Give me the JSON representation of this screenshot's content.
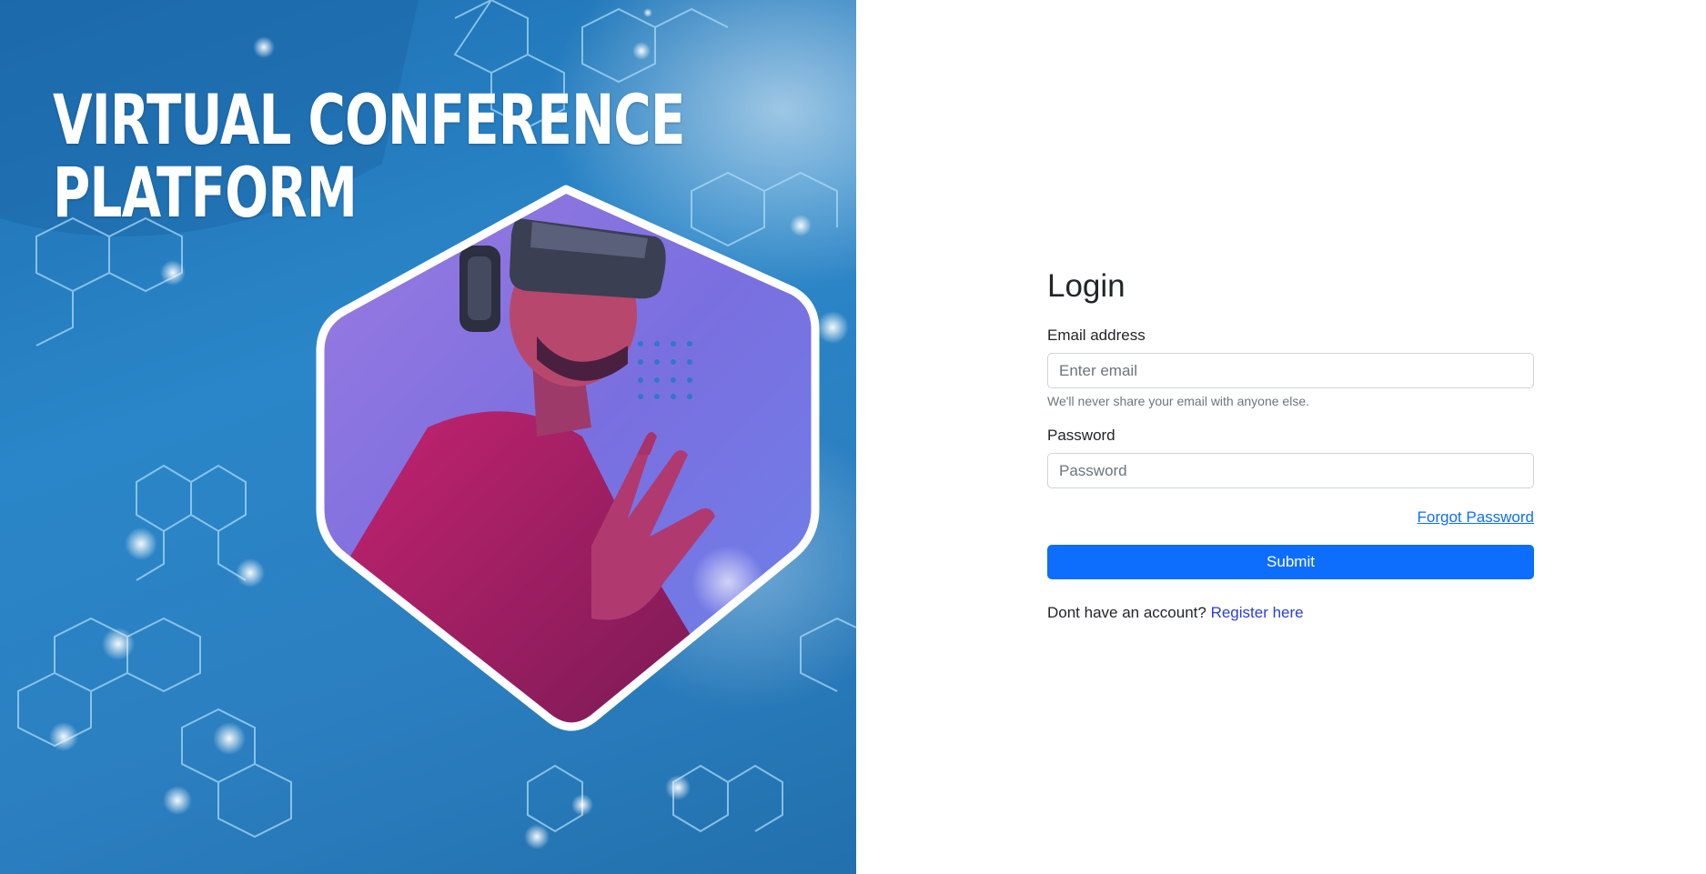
{
  "hero": {
    "title_line_1": "VIRTUAL CONFERENCE",
    "title_line_2": "PLATFORM",
    "image_subject": "person wearing VR headset inside hexagon frame"
  },
  "login": {
    "heading": "Login",
    "email": {
      "label": "Email address",
      "placeholder": "Enter email",
      "value": "",
      "help": "We'll never share your email with anyone else."
    },
    "password": {
      "label": "Password",
      "placeholder": "Password",
      "value": ""
    },
    "forgot_label": "Forgot Password",
    "submit_label": "Submit",
    "register_prompt": "Dont have an account?",
    "register_link": "Register here"
  },
  "colors": {
    "primary": "#0d6efd",
    "register_link": "#2a3ed8",
    "hero_blue": "#2a86c8",
    "text": "#212529",
    "muted": "#6c757d"
  }
}
